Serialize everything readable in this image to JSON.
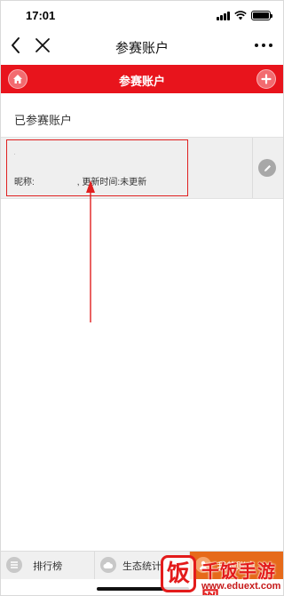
{
  "status_bar": {
    "time": "17:01"
  },
  "nav_bar": {
    "title": "参赛账户"
  },
  "red_header": {
    "title": "参赛账户"
  },
  "section": {
    "title": "已参赛账户"
  },
  "account": {
    "nickname_label": "昵称:",
    "update_label": ", 更新时间:",
    "update_value": "未更新"
  },
  "tabs": [
    {
      "label": "排行榜",
      "icon": "list-icon"
    },
    {
      "label": "生态统计",
      "icon": "cloud-icon"
    },
    {
      "label": "我的账户",
      "icon": "user-icon",
      "active": true
    }
  ],
  "watermark": {
    "logo_char": "饭",
    "name": "千饭手游网",
    "url": "www.eduext.com"
  },
  "colors": {
    "header_red": "#e8141c",
    "active_tab": "#e66a1a",
    "annotation_red": "#e02020"
  }
}
